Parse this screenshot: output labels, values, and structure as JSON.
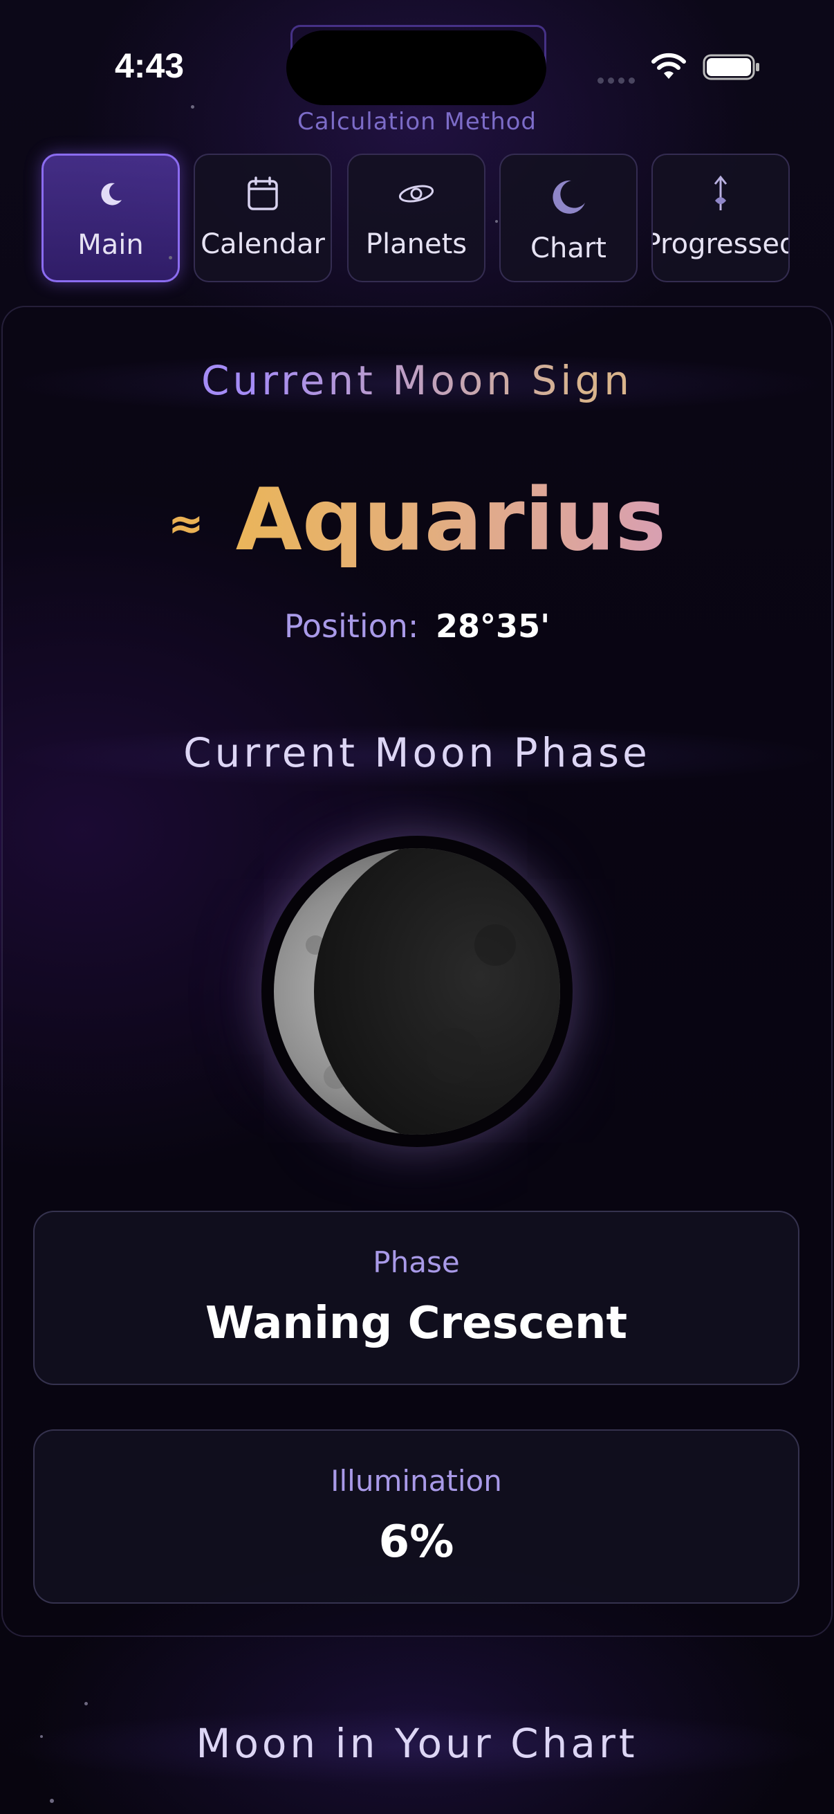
{
  "status_bar": {
    "time": "4:43"
  },
  "header": {
    "calc_method_label": "Calculation Method"
  },
  "tabs": [
    {
      "label": "Main",
      "icon": "crescent-moon-icon",
      "active": true
    },
    {
      "label": "Calendar",
      "icon": "calendar-icon",
      "active": false
    },
    {
      "label": "Planets",
      "icon": "planet-ring-icon",
      "active": false
    },
    {
      "label": "Chart",
      "icon": "moon-icon",
      "active": false
    },
    {
      "label": "Progressed",
      "icon": "arrows-updown-icon",
      "active": false
    }
  ],
  "moon_sign": {
    "title": "Current Moon Sign",
    "symbol": "≈",
    "sign": "Aquarius",
    "position_label": "Position:",
    "position_value": "28°35'"
  },
  "moon_phase": {
    "title": "Current Moon Phase",
    "phase_label": "Phase",
    "phase_value": "Waning Crescent",
    "illumination_label": "Illumination",
    "illumination_value": "6%"
  },
  "chart_section": {
    "title": "Moon in Your Chart"
  },
  "colors": {
    "accent_purple": "#8b6cf0",
    "label_lavender": "#a99ae8",
    "sign_gold": "#eab154",
    "sign_pink": "#d89fb2"
  }
}
